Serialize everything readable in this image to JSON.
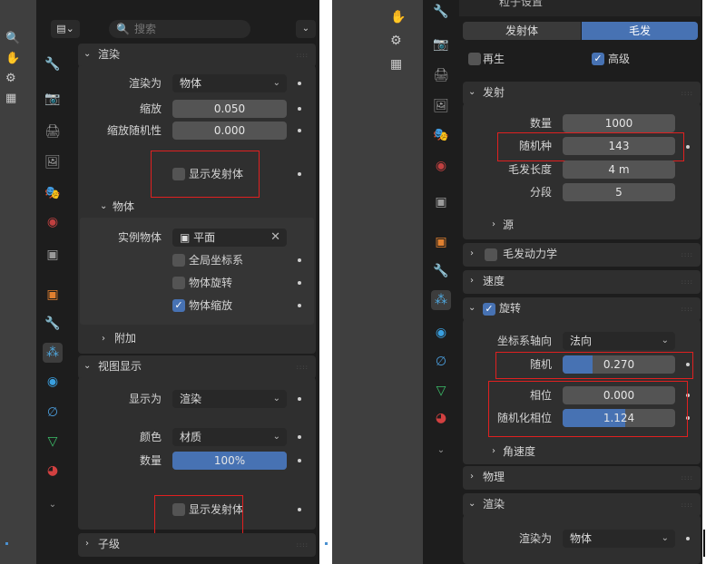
{
  "left": {
    "search_placeholder": "搜索",
    "render_section": {
      "title": "渲染",
      "render_as_label": "渲染为",
      "render_as_value": "物体",
      "scale_label": "缩放",
      "scale_value": "0.050",
      "scale_random_label": "缩放随机性",
      "scale_random_value": "0.000",
      "show_emitter_label": "显示发射体",
      "object_subsection": "物体",
      "instance_object_label": "实例物体",
      "instance_object_value": "平面",
      "global_coords_label": "全局坐标系",
      "object_rotation_label": "物体旋转",
      "object_scale_label": "物体缩放",
      "extra_label": "附加"
    },
    "viewport_display": {
      "title": "视图显示",
      "display_as_label": "显示为",
      "display_as_value": "渲染",
      "color_label": "颜色",
      "color_value": "材质",
      "amount_label": "数量",
      "amount_value": "100%",
      "amount_fraction": 1.0,
      "show_emitter_label": "显示发射体"
    },
    "children_section": "子级"
  },
  "right": {
    "header_title": "粒子设置",
    "type_tabs": [
      "发射体",
      "毛发"
    ],
    "regrow_label": "再生",
    "advanced_label": "高级",
    "emission": {
      "title": "发射",
      "number_label": "数量",
      "number_value": "1000",
      "seed_label": "随机种",
      "seed_value": "143",
      "hair_length_label": "毛发长度",
      "hair_length_value": "4 m",
      "segments_label": "分段",
      "segments_value": "5",
      "source_label": "源"
    },
    "hair_dynamics": "毛发动力学",
    "velocity": "速度",
    "rotation": {
      "title": "旋转",
      "orientation_axis_label": "坐标系轴向",
      "orientation_axis_value": "法向",
      "randomize_label": "随机",
      "randomize_value": "0.270",
      "randomize_fraction": 0.27,
      "phase_label": "相位",
      "phase_value": "0.000",
      "phase_fraction": 0.0,
      "random_phase_label": "随机化相位",
      "random_phase_value": "1.124",
      "random_phase_fraction": 0.56,
      "angular_velocity_label": "角速度"
    },
    "physics": "物理",
    "render": {
      "title": "渲染",
      "render_as_label": "渲染为",
      "render_as_value": "物体"
    }
  },
  "colors": {
    "accent": "#4772b3",
    "highlight_box": "#e02020",
    "panel_bg": "#1d1d1d"
  }
}
